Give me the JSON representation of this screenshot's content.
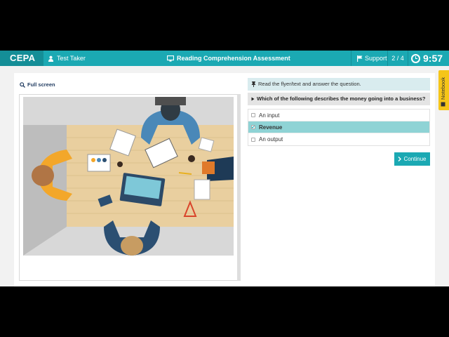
{
  "header": {
    "brand": "CEPA",
    "user_label": "Test Taker",
    "assessment_title": "Reading Comprehension Assessment",
    "support_label": "Support",
    "pager": "2 / 4",
    "timer": "9:57",
    "accent_color": "#1ba9b3"
  },
  "left_panel": {
    "fullscreen_label": "Full screen",
    "image_alt": "Top-down illustration of four people working at a wooden desk with laptop, notebooks and documents"
  },
  "question_panel": {
    "instruction": "Read the flyer/text and answer the question.",
    "question": "Which of the following describes the money going into a business?",
    "options": [
      {
        "label": "An input",
        "selected": false
      },
      {
        "label": "Revenue",
        "selected": true
      },
      {
        "label": "An output",
        "selected": false
      }
    ],
    "continue_label": "Continue"
  },
  "notebook": {
    "label": "Notebook"
  },
  "icons": [
    "user-icon",
    "monitor-icon",
    "flag-icon",
    "clock-icon",
    "search-icon",
    "pin-icon",
    "caret-icon",
    "chevron-right-icon",
    "notebook-icon"
  ]
}
